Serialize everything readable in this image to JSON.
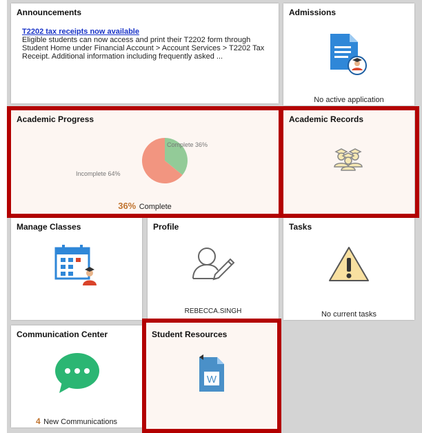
{
  "announcements": {
    "title": "Announcements",
    "link": "T2202 tax receipts now available",
    "body": "Eligible students can now access and print their T2202 form through Student Home under Financial Account > Account Services > T2202 Tax Receipt. Additional information including frequently asked ..."
  },
  "admissions": {
    "title": "Admissions",
    "status": "No active application"
  },
  "academic_progress": {
    "title": "Academic Progress",
    "percent": "36%",
    "percent_suffix": "Complete",
    "slice_complete": "Complete 36%",
    "slice_incomplete": "Incomplete 64%",
    "complete_color": "#93cb98",
    "incomplete_color": "#f29580"
  },
  "academic_records": {
    "title": "Academic Records"
  },
  "manage_classes": {
    "title": "Manage Classes"
  },
  "profile": {
    "title": "Profile",
    "name": "REBECCA.SINGH"
  },
  "tasks": {
    "title": "Tasks",
    "status": "No current tasks"
  },
  "communication": {
    "title": "Communication Center",
    "count": "4",
    "count_label": "New Communications"
  },
  "student_resources": {
    "title": "Student Resources"
  },
  "colors": {
    "highlight": "#b30000",
    "accent_orange": "#c0742f",
    "link": "#1a34c8"
  }
}
